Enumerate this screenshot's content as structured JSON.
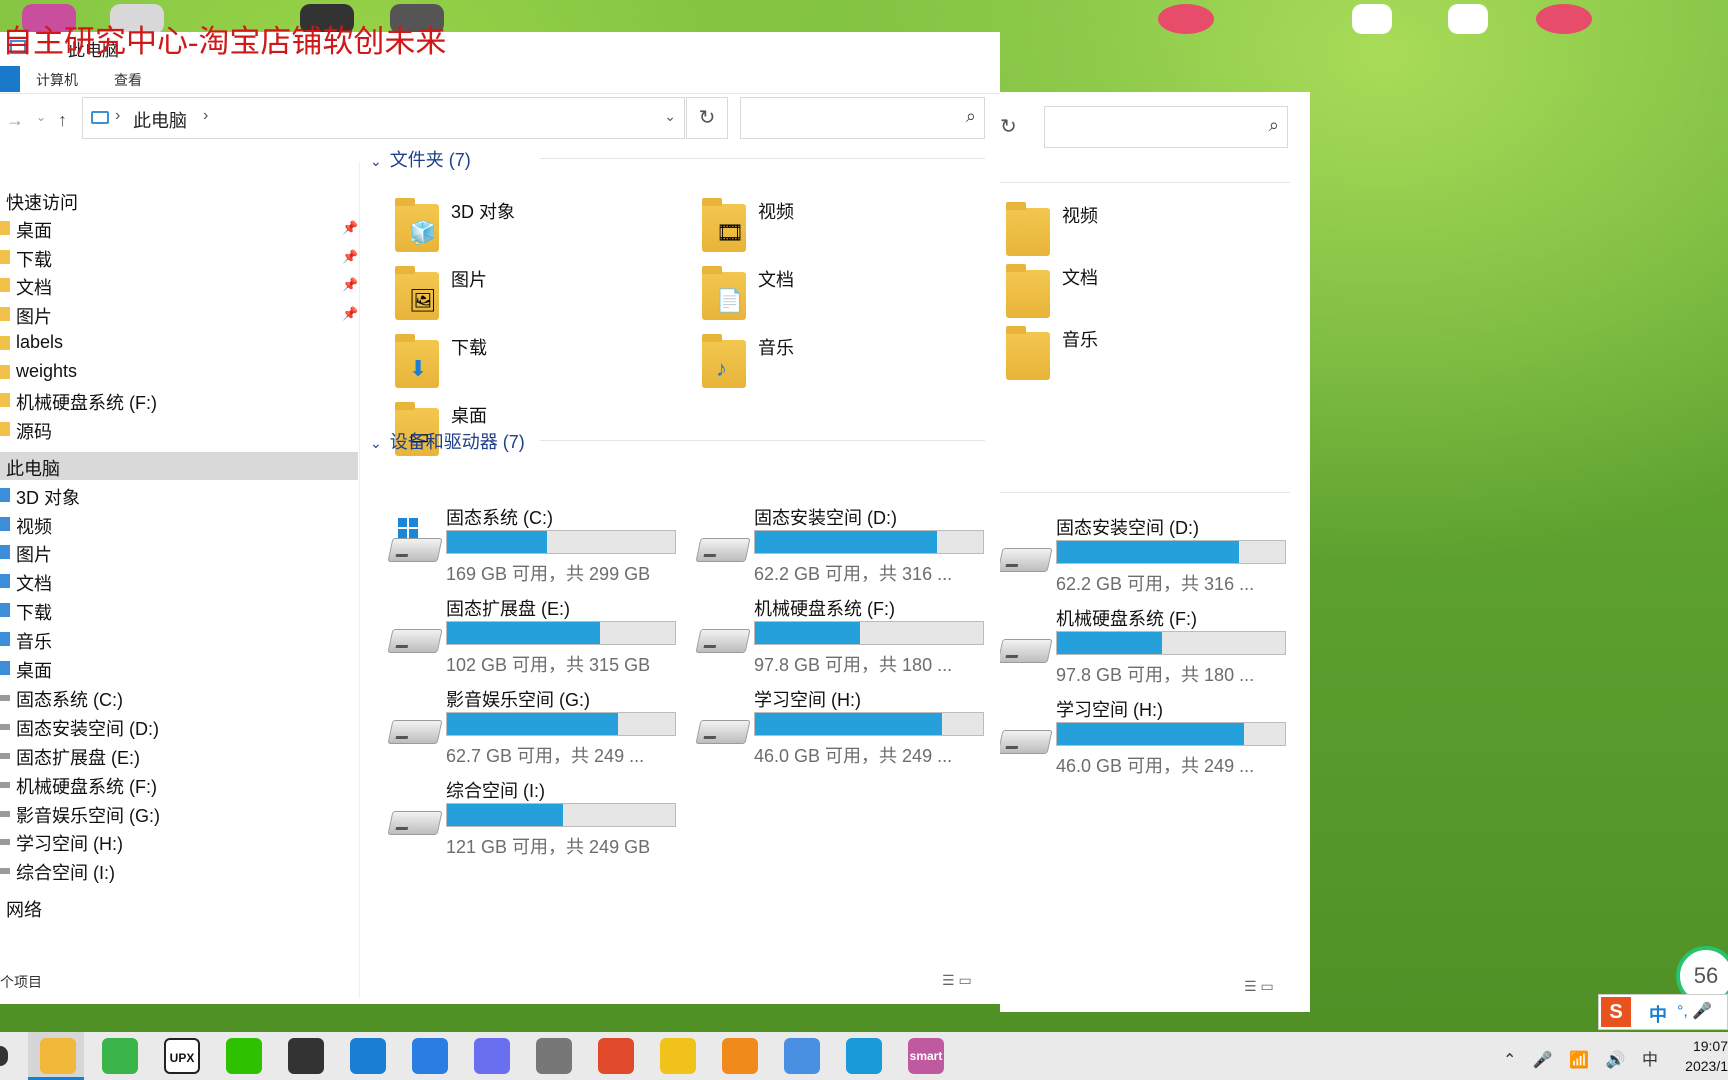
{
  "watermark": "自主研究中心-淘宝店铺软创未来",
  "window": {
    "title": "此电脑",
    "ribbon_tabs": [
      "计算机",
      "查看"
    ]
  },
  "address": {
    "crumb": "此电脑",
    "search_placeholder": ""
  },
  "nav": {
    "quick_access": "快速访问",
    "quick_items": [
      {
        "label": "桌面",
        "pinned": true
      },
      {
        "label": "下载",
        "pinned": true
      },
      {
        "label": "文档",
        "pinned": true
      },
      {
        "label": "图片",
        "pinned": true
      },
      {
        "label": "labels",
        "pinned": false
      },
      {
        "label": "weights",
        "pinned": false
      },
      {
        "label": "机械硬盘系统 (F:)",
        "pinned": false
      },
      {
        "label": "源码",
        "pinned": false
      }
    ],
    "this_pc": "此电脑",
    "pc_items": [
      "3D 对象",
      "视频",
      "图片",
      "文档",
      "下载",
      "音乐",
      "桌面",
      "固态系统 (C:)",
      "固态安装空间 (D:)",
      "固态扩展盘 (E:)",
      "机械硬盘系统 (F:)",
      "影音娱乐空间 (G:)",
      "学习空间 (H:)",
      "综合空间 (I:)"
    ],
    "network": "网络"
  },
  "status_text": "个项目",
  "folders_header": "文件夹 (7)",
  "folders": [
    {
      "label": "3D 对象",
      "glyph": "cube-icon"
    },
    {
      "label": "视频",
      "glyph": "film-icon"
    },
    {
      "label": "图片",
      "glyph": "picture-icon"
    },
    {
      "label": "文档",
      "glyph": "document-icon"
    },
    {
      "label": "下载",
      "glyph": "download-arrow-icon"
    },
    {
      "label": "音乐",
      "glyph": "music-note-icon"
    },
    {
      "label": "桌面",
      "glyph": "desktop-icon"
    }
  ],
  "drives_header": "设备和驱动器 (7)",
  "drives": [
    {
      "label": "固态系统 (C:)",
      "size": "169 GB 可用，共 299 GB",
      "used_fraction": 0.44,
      "system": true
    },
    {
      "label": "固态安装空间 (D:)",
      "size": "62.2 GB 可用，共 316 ...",
      "used_fraction": 0.8,
      "system": false
    },
    {
      "label": "固态扩展盘 (E:)",
      "size": "102 GB 可用，共 315 GB",
      "used_fraction": 0.67,
      "system": false
    },
    {
      "label": "机械硬盘系统 (F:)",
      "size": "97.8 GB 可用，共 180 ...",
      "used_fraction": 0.46,
      "system": false
    },
    {
      "label": "影音娱乐空间 (G:)",
      "size": "62.7 GB 可用，共 249 ...",
      "used_fraction": 0.75,
      "system": false
    },
    {
      "label": "学习空间 (H:)",
      "size": "46.0 GB 可用，共 249 ...",
      "used_fraction": 0.82,
      "system": false
    },
    {
      "label": "综合空间 (I:)",
      "size": "121 GB 可用，共 249 GB",
      "used_fraction": 0.51,
      "system": false
    }
  ],
  "ghost": {
    "folders": [
      "视频",
      "文档",
      "音乐"
    ],
    "drives": [
      {
        "label": "固态安装空间 (D:)",
        "size": "62.2 GB 可用，共 316 ...",
        "used_fraction": 0.8
      },
      {
        "label": "机械硬盘系统 (F:)",
        "size": "97.8 GB 可用，共 180 ...",
        "used_fraction": 0.46
      },
      {
        "label": "学习空间 (H:)",
        "size": "46.0 GB 可用，共 249 ...",
        "used_fraction": 0.82
      }
    ]
  },
  "taskbar": {
    "apps": [
      {
        "name": "file-explorer",
        "color": "#f2b83a",
        "text": ""
      },
      {
        "name": "browser",
        "color": "#3bb54a",
        "text": ""
      },
      {
        "name": "upx",
        "color": "#222222",
        "text": "UPX"
      },
      {
        "name": "wechat",
        "color": "#2dc100",
        "text": ""
      },
      {
        "name": "obs",
        "color": "#333333",
        "text": ""
      },
      {
        "name": "app-blue",
        "color": "#1a7fd4",
        "text": ""
      },
      {
        "name": "notes",
        "color": "#2a7de1",
        "text": ""
      },
      {
        "name": "app-purple",
        "color": "#6a6ff0",
        "text": ""
      },
      {
        "name": "docs",
        "color": "#777777",
        "text": ""
      },
      {
        "name": "puzzle",
        "color": "#e04a2a",
        "text": ""
      },
      {
        "name": "charts",
        "color": "#f0c21a",
        "text": ""
      },
      {
        "name": "avatar-app",
        "color": "#f08a1a",
        "text": ""
      },
      {
        "name": "media",
        "color": "#4a90e2",
        "text": ""
      },
      {
        "name": "todo",
        "color": "#1a9ad6",
        "text": ""
      },
      {
        "name": "smart",
        "color": "#c05aa0",
        "text": "smart"
      }
    ],
    "tray_lang": "中",
    "time": "19:07",
    "date": "2023/1"
  },
  "ime": {
    "s": "S",
    "zh": "中",
    "rest": "°, 🎤"
  },
  "speed_widget": "56"
}
